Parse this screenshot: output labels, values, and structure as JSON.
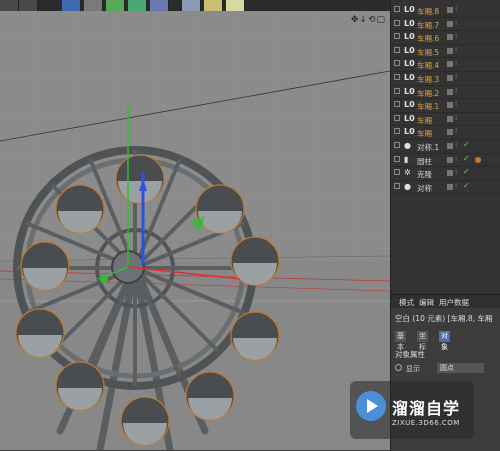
{
  "toolbar": {
    "buttons": [
      "film-icon",
      "film-icon",
      "cube-icon",
      "pen-icon",
      "gear-icon",
      "flower-icon",
      "brush-icon",
      "grid-icon",
      "camera-icon",
      "light-icon"
    ]
  },
  "viewport": {
    "nav_icons": "✥↓⟲▢"
  },
  "object_manager": {
    "rows": [
      {
        "icon": "L0",
        "name": "车厢.8",
        "color": "#e8a040",
        "check": false,
        "tag": false
      },
      {
        "icon": "L0",
        "name": "车厢.7",
        "color": "#e8a040",
        "check": false,
        "tag": false
      },
      {
        "icon": "L0",
        "name": "车厢.6",
        "color": "#e8a040",
        "check": false,
        "tag": false
      },
      {
        "icon": "L0",
        "name": "车厢.5",
        "color": "#e8a040",
        "check": false,
        "tag": false
      },
      {
        "icon": "L0",
        "name": "车厢.4",
        "color": "#e8a040",
        "check": false,
        "tag": false
      },
      {
        "icon": "L0",
        "name": "车厢.3",
        "color": "#e8a040",
        "check": false,
        "tag": false
      },
      {
        "icon": "L0",
        "name": "车厢.2",
        "color": "#e8a040",
        "check": false,
        "tag": false
      },
      {
        "icon": "L0",
        "name": "车厢.1",
        "color": "#e8a040",
        "check": false,
        "tag": false
      },
      {
        "icon": "L0",
        "name": "车厢",
        "color": "#e8a040",
        "check": false,
        "tag": false
      },
      {
        "icon": "L0",
        "name": "车厢",
        "color": "#e8a040",
        "check": false,
        "tag": false
      },
      {
        "icon": "●",
        "name": "对称.1",
        "color": "#d0d0d0",
        "check": true,
        "tag": false
      },
      {
        "icon": "▮",
        "name": "圆柱",
        "color": "#d0d0d0",
        "check": true,
        "tag": true
      },
      {
        "icon": "✲",
        "name": "克隆",
        "color": "#d0d0d0",
        "check": true,
        "tag": false
      },
      {
        "icon": "●",
        "name": "对称",
        "color": "#d0d0d0",
        "check": true,
        "tag": false
      }
    ]
  },
  "attributes": {
    "tabs": [
      "模式",
      "编辑",
      "用户数据"
    ],
    "title": "空白 (10 元素) [车厢.8, 车厢",
    "subtabs": [
      "基本",
      "坐标",
      "对象"
    ],
    "active_subtab": "对象",
    "section": "对象属性",
    "display_label": "显示",
    "display_value": "圆点"
  },
  "watermark": {
    "title": "溜溜自学",
    "url": "ZIXUE.3D66.COM"
  }
}
